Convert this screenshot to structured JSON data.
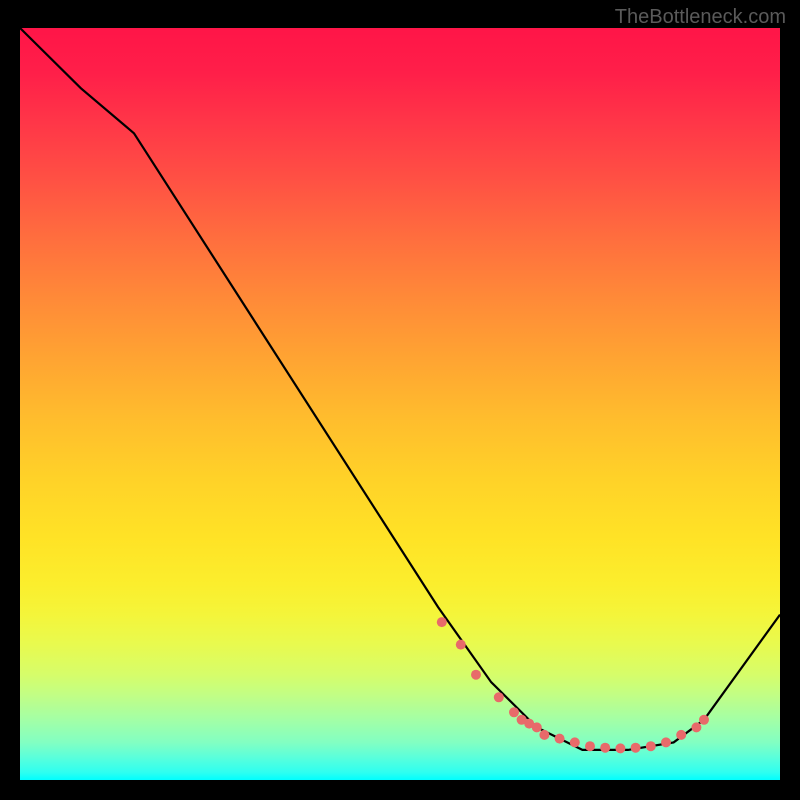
{
  "watermark": "TheBottleneck.com",
  "chart_data": {
    "type": "line",
    "title": "",
    "xlabel": "",
    "ylabel": "",
    "xlim": [
      0,
      100
    ],
    "ylim": [
      0,
      100
    ],
    "series": [
      {
        "name": "curve",
        "x": [
          0,
          8,
          15,
          55,
          62,
          68,
          74,
          80,
          86,
          90,
          100
        ],
        "y": [
          100,
          92,
          86,
          23,
          13,
          7,
          4,
          4,
          5,
          8,
          22
        ]
      }
    ],
    "markers": {
      "x": [
        55.5,
        58,
        60,
        63,
        65,
        66,
        67,
        68,
        69,
        71,
        73,
        75,
        77,
        79,
        81,
        83,
        85,
        87,
        89,
        90
      ],
      "y": [
        21,
        18,
        14,
        11,
        9,
        8,
        7.5,
        7,
        6,
        5.5,
        5,
        4.5,
        4.3,
        4.2,
        4.3,
        4.5,
        5,
        6,
        7,
        8
      ],
      "color": "#e86a6a"
    },
    "background": "rainbow-vertical-gradient"
  }
}
